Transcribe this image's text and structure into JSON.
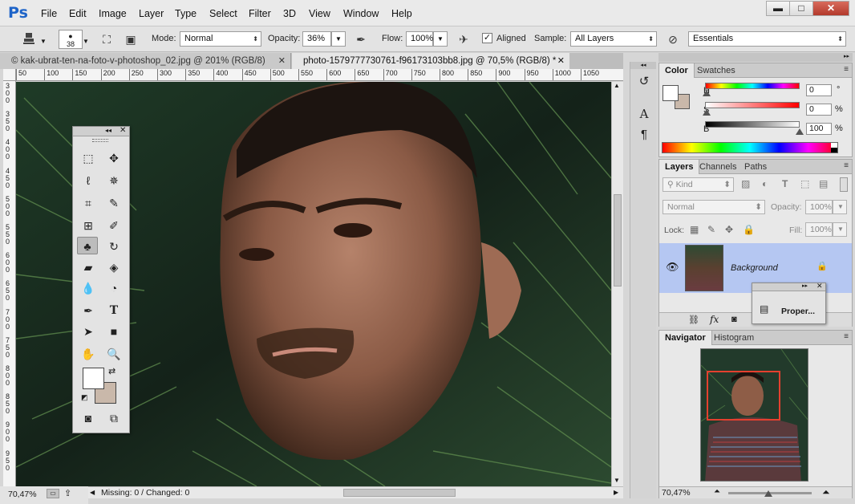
{
  "app": {
    "logo": "Ps"
  },
  "menu": [
    "File",
    "Edit",
    "Image",
    "Layer",
    "Type",
    "Select",
    "Filter",
    "3D",
    "View",
    "Window",
    "Help"
  ],
  "window_controls": {
    "minimize": "▬",
    "maximize": "□",
    "close": "✕"
  },
  "options_bar": {
    "brush_size": "38",
    "mode_label": "Mode:",
    "mode_value": "Normal",
    "opacity_label": "Opacity:",
    "opacity_value": "36%",
    "flow_label": "Flow:",
    "flow_value": "100%",
    "aligned_label": "Aligned",
    "aligned_checked": true,
    "sample_label": "Sample:",
    "sample_value": "All Layers",
    "workspace_value": "Essentials"
  },
  "doc_tabs": [
    {
      "label": "© kak-ubrat-ten-na-foto-v-photoshop_02.jpg @ 201% (RGB/8)",
      "active": false
    },
    {
      "label": "photo-1579777730761-f96173103bb8.jpg @ 70,5% (RGB/8) *",
      "active": true
    }
  ],
  "ruler": {
    "top": [
      "50",
      "100",
      "150",
      "200",
      "250",
      "300",
      "350",
      "400",
      "450",
      "500",
      "550",
      "600",
      "650",
      "700",
      "750",
      "800",
      "850",
      "900",
      "950",
      "1000",
      "1050"
    ],
    "left": [
      "3 0 0",
      "3 5 0",
      "4 0 0",
      "4 5 0",
      "5 0 0",
      "5 5 0",
      "6 0 0",
      "6 5 0",
      "7 0 0",
      "7 5 0",
      "8 0 0",
      "8 5 0",
      "9 0 0",
      "9 5 0"
    ]
  },
  "status": {
    "zoom": "70,47%",
    "info": "Missing: 0 / Changed: 0"
  },
  "color_panel": {
    "tabs": [
      "Color",
      "Swatches"
    ],
    "h_label": "H",
    "h_value": "0",
    "h_unit": "°",
    "s_label": "S",
    "s_value": "0",
    "s_unit": "%",
    "b_label": "B",
    "b_value": "100",
    "b_unit": "%"
  },
  "layers_panel": {
    "tabs": [
      "Layers",
      "Channels",
      "Paths"
    ],
    "kind_placeholder": "Kind",
    "blend_value": "Normal",
    "opacity_label": "Opacity:",
    "opacity_value": "100%",
    "lock_label": "Lock:",
    "fill_label": "Fill:",
    "fill_value": "100%",
    "layers": [
      {
        "name": "Background",
        "visible": true,
        "locked": true
      }
    ]
  },
  "properties_float": {
    "label": "Proper..."
  },
  "navigator_panel": {
    "tabs": [
      "Navigator",
      "Histogram"
    ],
    "zoom": "70,47%"
  },
  "colors": {
    "foreground": "#ffffff",
    "background": "#c9b8aa",
    "nav_rect": "#e4402f",
    "ps_blue": "#1e64c8"
  }
}
